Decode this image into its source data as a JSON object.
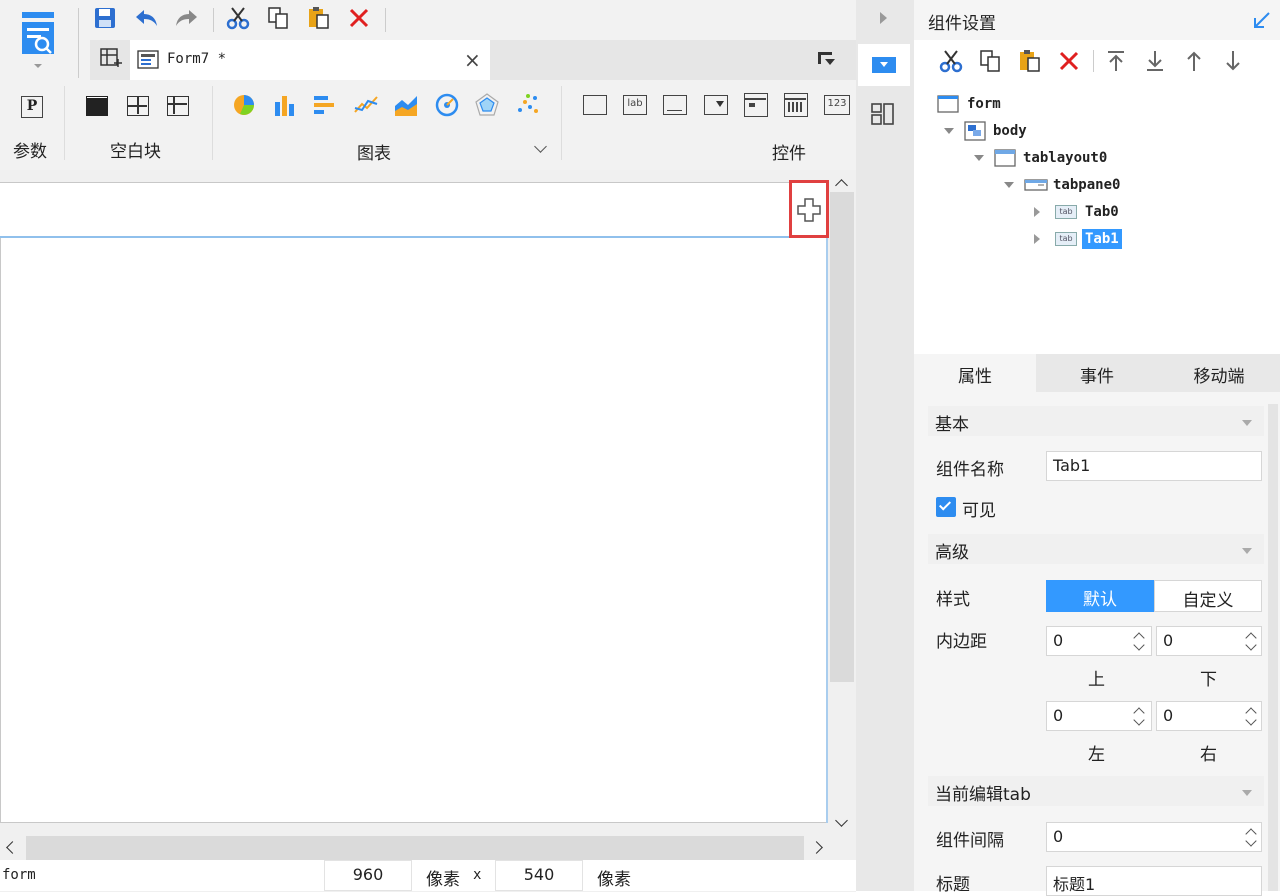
{
  "editor": {
    "tab_title": "Form7 *",
    "groups": {
      "param": "参数",
      "blank": "空白块",
      "chart": "图表",
      "controls": "控件"
    },
    "ctl_label_text": "lab",
    "ctl_number_text": "123"
  },
  "status_bar": {
    "selected": "form",
    "width": "960",
    "unit1": "像素",
    "sep": "x",
    "height": "540",
    "unit2": "像素"
  },
  "panel": {
    "title": "组件设置",
    "tree": [
      {
        "label": "form"
      },
      {
        "label": "body"
      },
      {
        "label": "tablayout0"
      },
      {
        "label": "tabpane0"
      },
      {
        "label": "Tab0"
      },
      {
        "label": "Tab1"
      }
    ],
    "tabs": [
      "属性",
      "事件",
      "移动端"
    ],
    "sections": {
      "basic": "基本",
      "advanced": "高级",
      "current_tab": "当前编辑tab"
    },
    "props": {
      "name_label": "组件名称",
      "name_value": "Tab1",
      "visible_label": "可见",
      "style_label": "样式",
      "style_options": [
        "默认",
        "自定义"
      ],
      "padding_label": "内边距",
      "pad_top": "0",
      "pad_bottom": "0",
      "pad_left": "0",
      "pad_right": "0",
      "top_label": "上",
      "bottom_label": "下",
      "left_label": "左",
      "right_label": "右",
      "gap_label": "组件间隔",
      "gap_value": "0",
      "title_label": "标题",
      "title_value": "标题1"
    }
  },
  "colors": {
    "accent": "#2d8cf0",
    "selected_bg": "#3399ff",
    "highlight_box": "#e04040"
  }
}
